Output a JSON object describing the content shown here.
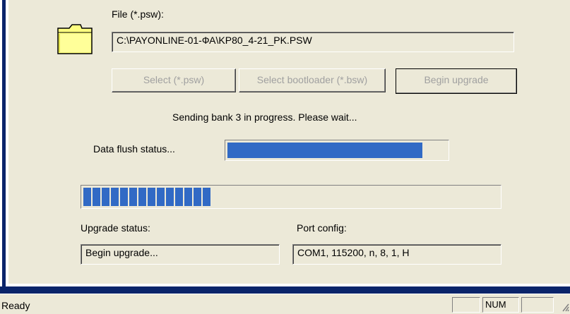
{
  "file": {
    "label": "File (*.psw):",
    "path": "C:\\PAYONLINE-01-ФА\\KP80_4-21_PK.PSW"
  },
  "buttons": {
    "select_psw": "Select (*.psw)",
    "select_bootloader": "Select bootloader (*.bsw)",
    "begin_upgrade": "Begin upgrade"
  },
  "message": "Sending bank 3 in progress. Please wait...",
  "data_flush": {
    "label": "Data flush status...",
    "progress_fraction": 0.89
  },
  "upgrade_progress": {
    "filled_segments": 14
  },
  "upgrade_status": {
    "label": "Upgrade status:",
    "value": "Begin upgrade..."
  },
  "port_config": {
    "label": "Port config:",
    "value": "COM1, 115200, n, 8, 1, H"
  },
  "statusbar": {
    "text": "Ready",
    "num": "NUM"
  },
  "colors": {
    "progress": "#316ac5",
    "frame": "#0a246a",
    "disabled_text": "#a0a0a0"
  },
  "icons": [
    "folder-icon",
    "size-grip-icon"
  ]
}
